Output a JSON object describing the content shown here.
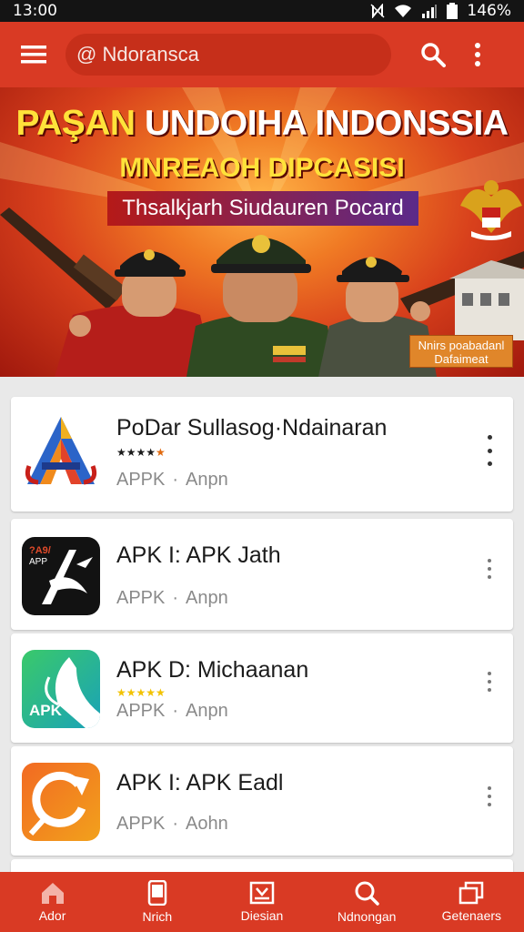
{
  "status_bar": {
    "time": "13:00",
    "battery_text": "146%",
    "icons": [
      "nfc-icon",
      "wifi-icon",
      "signal-icon",
      "battery-icon"
    ]
  },
  "app_bar": {
    "search_text": "@ Ndoransca",
    "icons": [
      "menu-icon",
      "search-icon",
      "more-vert-icon"
    ],
    "color": "#d93a24"
  },
  "banner": {
    "title_part1": "PAŞAN",
    "title_part2": "UNDOIHA INDONSSIA",
    "subtitle": "MNREAOH DIPCASISI",
    "ribbon": "Thsalkjarh Siudauren Pocard",
    "tag": "Nnirs poabadanl Dafaimeat"
  },
  "apps": [
    {
      "title": "PoDar Sullasog·Ndainaran",
      "meta_left": "APPK",
      "meta_sep": "·",
      "meta_right": "Anpn",
      "stars": "★★★★★",
      "icon": "aa-logo-icon"
    },
    {
      "title": "APK I: APK Jath",
      "meta_left": "APPK",
      "meta_sep": "·",
      "meta_right": "Anpn",
      "icon": "apk-x-logo-icon",
      "icon_text": "APP"
    },
    {
      "title": "APK  D: Michaanan",
      "meta_left": "APPK",
      "meta_sep": "·",
      "meta_right": "Anpn",
      "stars": "★★★★★",
      "icon": "apk-green-logo-icon",
      "icon_text": "APK"
    },
    {
      "title": "APK I: APK Eadl",
      "meta_left": "APPK",
      "meta_sep": "·",
      "meta_right": "Aohn",
      "icon": "refresh-logo-icon"
    }
  ],
  "bottom_nav": [
    {
      "label": "Ador",
      "icon": "home-icon"
    },
    {
      "label": "Nrich",
      "icon": "phone-icon"
    },
    {
      "label": "Diesian",
      "icon": "download-box-icon"
    },
    {
      "label": "Ndnongan",
      "icon": "search-icon"
    },
    {
      "label": "Getenaers",
      "icon": "windows-icon"
    }
  ]
}
